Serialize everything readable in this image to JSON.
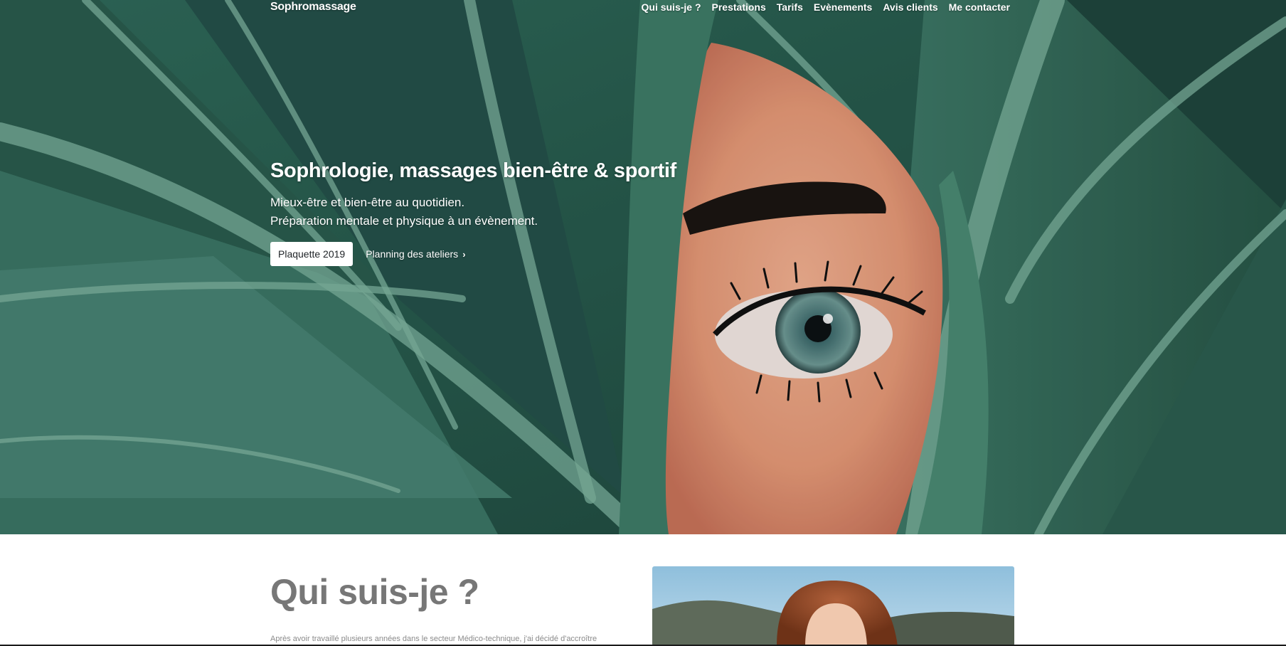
{
  "navbar": {
    "brand": "Sophromassage",
    "links": [
      {
        "label": "Qui suis-je ?"
      },
      {
        "label": "Prestations"
      },
      {
        "label": "Tarifs"
      },
      {
        "label": "Evènements"
      },
      {
        "label": "Avis clients"
      },
      {
        "label": "Me contacter"
      }
    ]
  },
  "hero": {
    "title": "Sophrologie, massages bien-être & sportif",
    "lead_line_1": "Mieux-être et bien-être au quotidien.",
    "lead_line_2": "Préparation mentale et physique à un évènement.",
    "primary_button": "Plaquette 2019",
    "secondary_link": "Planning des ateliers",
    "secondary_link_icon": "chevron-right-icon"
  },
  "about": {
    "title": "Qui suis-je ?",
    "text": "Après avoir travaillé plusieurs années dans le secteur Médico-technique, j'ai décidé d'accroître"
  },
  "colors": {
    "hero_leaf_dark": "#1f4a40",
    "hero_leaf_light": "#4f8a76",
    "skin": "#e8966e",
    "about_title": "#777777",
    "about_text": "#8a8a8a"
  }
}
